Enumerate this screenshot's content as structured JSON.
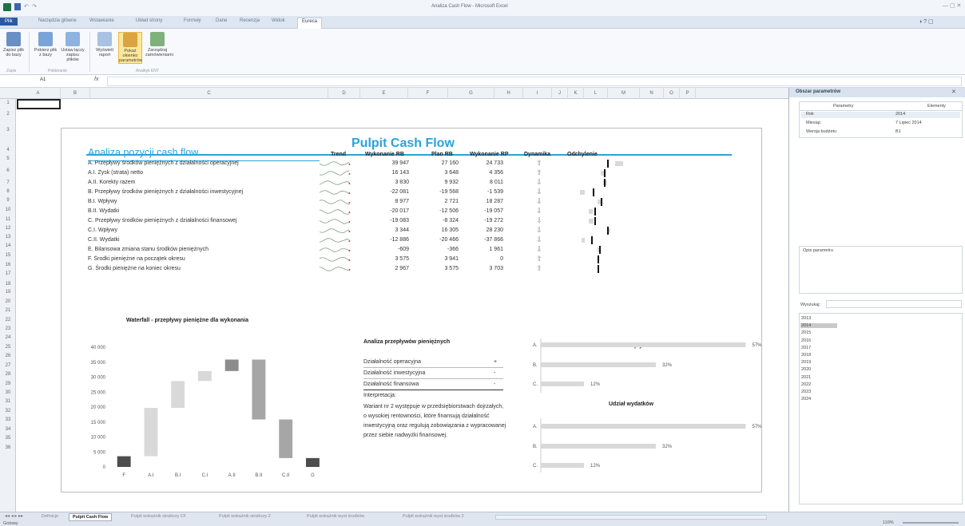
{
  "app": {
    "title": "Analiza Cash Flow - Microsoft Excel"
  },
  "ribbon_tabs": [
    "Plik",
    "Narzędzia główne",
    "Wstawianie",
    "Układ strony",
    "Formuły",
    "Dane",
    "Recenzja",
    "Widok",
    "Eureca"
  ],
  "ribbon": {
    "buttons": [
      {
        "label": "Zapisz plik do bazy",
        "icon": "database-save-icon"
      },
      {
        "label": "Pobierz plik z bazy",
        "icon": "download-icon"
      },
      {
        "label": "Ustaw łączy zapisu plików",
        "icon": "link-icon"
      },
      {
        "label": "Wyświetl raport",
        "icon": "report-icon"
      },
      {
        "label": "Pokaż okienko parametrów",
        "icon": "parameters-icon"
      },
      {
        "label": "Zarządzaj zamówieniami",
        "icon": "manage-icon"
      }
    ],
    "groups": [
      "Zapis",
      "Pobieranie",
      "Analityk ENT"
    ]
  },
  "formula_bar": {
    "cell_ref": "A1",
    "fx": "fx",
    "value": ""
  },
  "columns": [
    "A",
    "B",
    "C",
    "D",
    "E",
    "F",
    "G",
    "H",
    "I",
    "J",
    "K",
    "L",
    "M",
    "N",
    "O",
    "P"
  ],
  "rows": [
    "1",
    "2",
    "3",
    "4",
    "5",
    "6",
    "7",
    "8",
    "9",
    "10",
    "11",
    "12",
    "13",
    "14",
    "15",
    "16",
    "17",
    "18",
    "19",
    "20",
    "21",
    "22",
    "23",
    "24",
    "25",
    "26",
    "27",
    "28",
    "29",
    "30",
    "31",
    "32",
    "33",
    "34",
    "35",
    "36"
  ],
  "dashboard": {
    "title": "Pulpit Cash Flow",
    "section": "Analiza pozycji cash flow",
    "headers": {
      "trend": "Trend",
      "wyk_rb": "Wykonanie RB",
      "plan_rb": "Plan RB",
      "wyk_rp": "Wykonanie RP",
      "dyn": "Dynamika",
      "odch": "Odchylenie"
    },
    "rows": [
      {
        "label": "A. Przepływy środków pieniężnych z działalności operacyjnej",
        "wyk_rb": "39 947",
        "plan_rb": "27 160",
        "wyk_rp": "24 733",
        "dir": "up"
      },
      {
        "label": "A.I. Zysk (strata) netto",
        "wyk_rb": "16 143",
        "plan_rb": "3 648",
        "wyk_rp": "4 356",
        "dir": "up"
      },
      {
        "label": "A.II. Korekty razem",
        "wyk_rb": "3 830",
        "plan_rb": "9 932",
        "wyk_rp": "8 011",
        "dir": "down"
      },
      {
        "label": "B. Przepływy środków pieniężnych z działalności inwestycyjnej",
        "wyk_rb": "-22 081",
        "plan_rb": "-19 568",
        "wyk_rp": "-1 539",
        "dir": "down"
      },
      {
        "label": "B.I. Wpływy",
        "wyk_rb": "8 977",
        "plan_rb": "2 721",
        "wyk_rp": "18 287",
        "dir": "down"
      },
      {
        "label": "B.II. Wydatki",
        "wyk_rb": "-20 017",
        "plan_rb": "-12 506",
        "wyk_rp": "-19 057",
        "dir": "down"
      },
      {
        "label": "C. Przepływy środków pieniężnych z działalności finansowej",
        "wyk_rb": "-19 083",
        "plan_rb": "-8 324",
        "wyk_rp": "-19 272",
        "dir": "down"
      },
      {
        "label": "C.I. Wpływy",
        "wyk_rb": "3 344",
        "plan_rb": "16 305",
        "wyk_rp": "28 230",
        "dir": "down"
      },
      {
        "label": "C.II. Wydatki",
        "wyk_rb": "-12 886",
        "plan_rb": "-20 466",
        "wyk_rp": "-37 866",
        "dir": "down"
      },
      {
        "label": "E. Bilansowa zmiana stanu środków pieniężnych",
        "wyk_rb": "-609",
        "plan_rb": "-366",
        "wyk_rp": "1 961",
        "dir": "down"
      },
      {
        "label": "F. Środki pieniężne na początek okresu",
        "wyk_rb": "3 575",
        "plan_rb": "3 941",
        "wyk_rp": "0",
        "dir": "up"
      },
      {
        "label": "G. Środki pieniężne na koniec okresu",
        "wyk_rb": "2 967",
        "plan_rb": "3 575",
        "wyk_rp": "3 703",
        "dir": "up"
      }
    ],
    "analysis": {
      "title": "Analiza przepływów pieniężnych",
      "items": [
        {
          "label": "Działalność operacyjna",
          "sign": "+"
        },
        {
          "label": "Działalność inwestycyjna",
          "sign": "-"
        },
        {
          "label": "Działalność finansowa",
          "sign": "-"
        }
      ],
      "interp_label": "Interpretacja:",
      "interp_text": "Wariant nr 2 występuje w przedsiębiorstwach dojrzałych, o wysokiej rentowności, które finansują działalność inwestycyjną oraz regulują zobowiązania z wypracowanej przez siebie nadwyżki finansowej."
    }
  },
  "chart_data": [
    {
      "type": "bar",
      "title": "Waterfall - przepływy pieniężne dla wykonania",
      "categories": [
        "F",
        "A.I",
        "B.I",
        "C.I",
        "A.II",
        "B.II",
        "C.II",
        "G"
      ],
      "values": [
        {
          "start": 0,
          "end": 3575
        },
        {
          "start": 3575,
          "end": 19718
        },
        {
          "start": 19718,
          "end": 28695
        },
        {
          "start": 28695,
          "end": 32039
        },
        {
          "start": 32039,
          "end": 35869
        },
        {
          "start": 35869,
          "end": 15852
        },
        {
          "start": 15852,
          "end": 2966
        },
        {
          "start": 0,
          "end": 2967
        }
      ],
      "colors": [
        "#4d4d4d",
        "#d9d9d9",
        "#d9d9d9",
        "#d9d9d9",
        "#8c8c8c",
        "#a6a6a6",
        "#a6a6a6",
        "#4d4d4d"
      ],
      "ylim": [
        0,
        40000
      ],
      "yticks": [
        "0",
        "5 000",
        "10 000",
        "15 000",
        "20 000",
        "25 000",
        "30 000",
        "35 000",
        "40 000"
      ]
    },
    {
      "type": "bar",
      "orientation": "horizontal",
      "title": "Udział wpływów",
      "categories": [
        "A",
        "B",
        "C"
      ],
      "values": [
        57,
        32,
        12
      ],
      "labels": [
        "57%",
        "32%",
        "12%"
      ],
      "xlim": [
        0,
        60
      ]
    },
    {
      "type": "bar",
      "orientation": "horizontal",
      "title": "Udział wydatków",
      "categories": [
        "A",
        "B",
        "C"
      ],
      "values": [
        57,
        32,
        12
      ],
      "labels": [
        "57%",
        "32%",
        "12%"
      ],
      "xlim": [
        0,
        60
      ]
    }
  ],
  "sheet_tabs": [
    "Definicje",
    "Pulpit Cash Flow",
    "Pulpit wskaźnik struktury CF",
    "Pulpit wskaźnik struktury 2",
    "Pulpit wskaźnik wyst środków",
    "Pulpit wskaźnik wyst środków 2"
  ],
  "status": {
    "ready": "Gotowy",
    "zoom": "110%"
  },
  "panel": {
    "title": "Obszar parametrów",
    "col_param": "Parametry",
    "col_elem": "Elementy",
    "params": [
      {
        "name": "Rok",
        "value": "2014"
      },
      {
        "name": "Miesiąc",
        "value": "7 Lipiec 2014"
      },
      {
        "name": "Wersja budżetu",
        "value": "B1"
      }
    ],
    "desc_label": "Opis parametru",
    "search_label": "Wyszukaj:",
    "years": [
      "2013",
      "2014",
      "2015",
      "2016",
      "2017",
      "2018",
      "2019",
      "2020",
      "2021",
      "2022",
      "2023",
      "2024"
    ],
    "selected_year": "2014"
  }
}
